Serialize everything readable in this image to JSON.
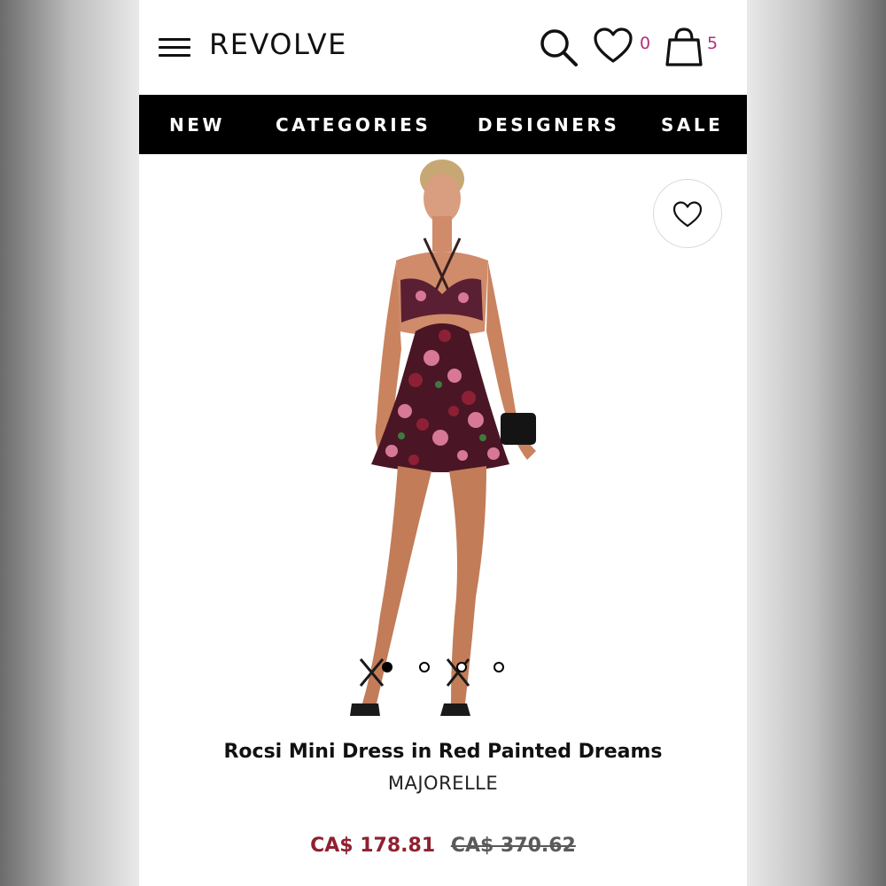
{
  "header": {
    "logo": "REVOLVE",
    "wishlist_count": "0",
    "bag_count": "5"
  },
  "nav": {
    "items": [
      "NEW",
      "CATEGORIES",
      "DESIGNERS",
      "SALE"
    ]
  },
  "gallery": {
    "total_images": 4,
    "active_index": 0
  },
  "product": {
    "title": "Rocsi Mini Dress in Red Painted Dreams",
    "brand": "MAJORELLE",
    "sale_price": "CA$ 178.81",
    "original_price": "CA$ 370.62"
  },
  "colors": {
    "count_accent": "#b0307a",
    "sale_price": "#8e2130",
    "nav_bg": "#000000"
  },
  "icons": [
    "menu-icon",
    "search-icon",
    "heart-icon",
    "shopping-bag-icon"
  ]
}
